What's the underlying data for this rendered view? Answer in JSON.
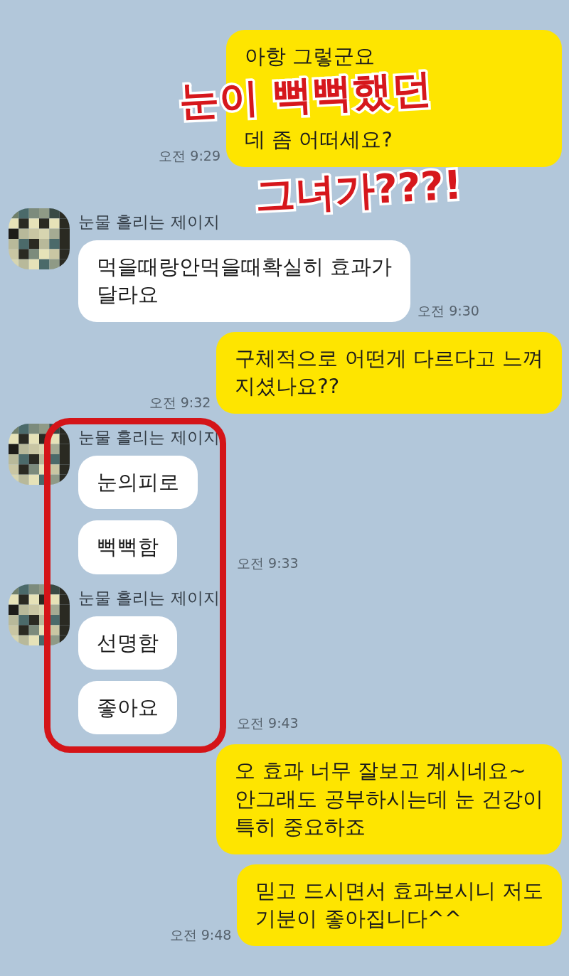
{
  "messages": [
    {
      "kind": "sent",
      "lines": [
        "아항 그렇군요",
        "데 좀 어떠세요?"
      ],
      "covered": true,
      "time": "오전 9:29",
      "highlighted": false
    },
    {
      "kind": "received",
      "sender": "눈물 흘리는 제이지",
      "bubbles": [
        {
          "lines": [
            "먹을때랑안먹을때확실히 효과가",
            "달라요"
          ]
        }
      ],
      "time": "오전 9:30",
      "highlighted": false
    },
    {
      "kind": "sent",
      "lines": [
        "구체적으로 어떤게 다르다고 느껴",
        "지셨나요??"
      ],
      "time": "오전 9:32",
      "highlighted": false
    },
    {
      "kind": "received",
      "sender": "눈물 흘리는 제이지",
      "bubbles": [
        {
          "lines": [
            "눈의피로"
          ]
        },
        {
          "lines": [
            "뻑뻑함"
          ]
        }
      ],
      "time": "오전 9:33",
      "highlighted": true
    },
    {
      "kind": "received",
      "sender": "눈물 흘리는 제이지",
      "bubbles": [
        {
          "lines": [
            "선명함"
          ]
        },
        {
          "lines": [
            "좋아요"
          ]
        }
      ],
      "time": "오전 9:43",
      "highlighted": true
    },
    {
      "kind": "sent",
      "lines": [
        "오 효과 너무 잘보고 계시네요~",
        "안그래도 공부하시는데 눈 건강이",
        "특히 중요하죠"
      ],
      "highlighted": false
    },
    {
      "kind": "sent",
      "lines": [
        "믿고 드시면서 효과보시니 저도",
        "기분이 좋아집니다^^"
      ],
      "time": "오전 9:48",
      "highlighted": false
    }
  ],
  "caption": {
    "lines": [
      "눈이 뻑뻑했던",
      "그녀가???!"
    ]
  }
}
